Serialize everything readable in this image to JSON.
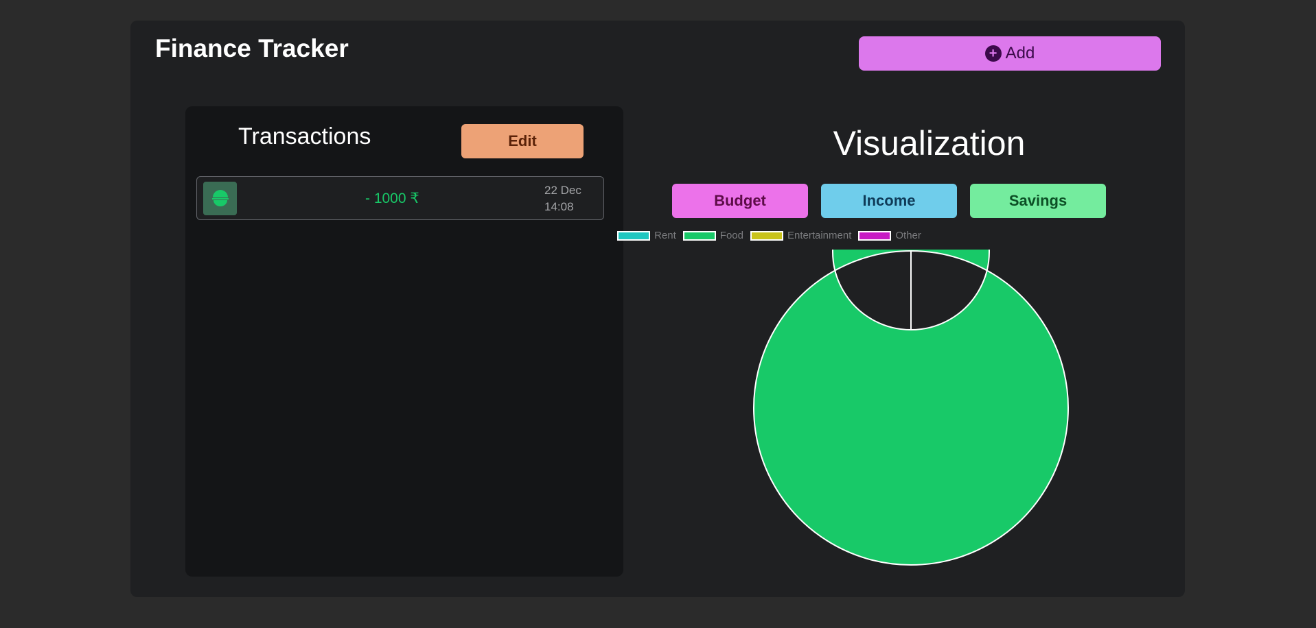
{
  "app": {
    "title": "Finance Tracker",
    "add_label": "Add"
  },
  "transactions": {
    "title": "Transactions",
    "edit_label": "Edit",
    "items": [
      {
        "icon": "food-bowl-icon",
        "amount": "- 1000 ₹",
        "date": "22 Dec",
        "time": "14:08"
      }
    ]
  },
  "visualization": {
    "title": "Visualization",
    "tabs": [
      {
        "label": "Budget",
        "color": "#ec72ea"
      },
      {
        "label": "Income",
        "color": "#6fcdeb"
      },
      {
        "label": "Savings",
        "color": "#74ec9e"
      }
    ]
  },
  "chart_data": {
    "type": "pie",
    "donut": true,
    "legend_position": "top",
    "categories": [
      "Rent",
      "Food",
      "Entertainment",
      "Other"
    ],
    "values": [
      0,
      1000,
      0,
      0
    ],
    "colors": [
      "#1fc7c0",
      "#18c968",
      "#c9c31c",
      "#c71bc4"
    ]
  }
}
